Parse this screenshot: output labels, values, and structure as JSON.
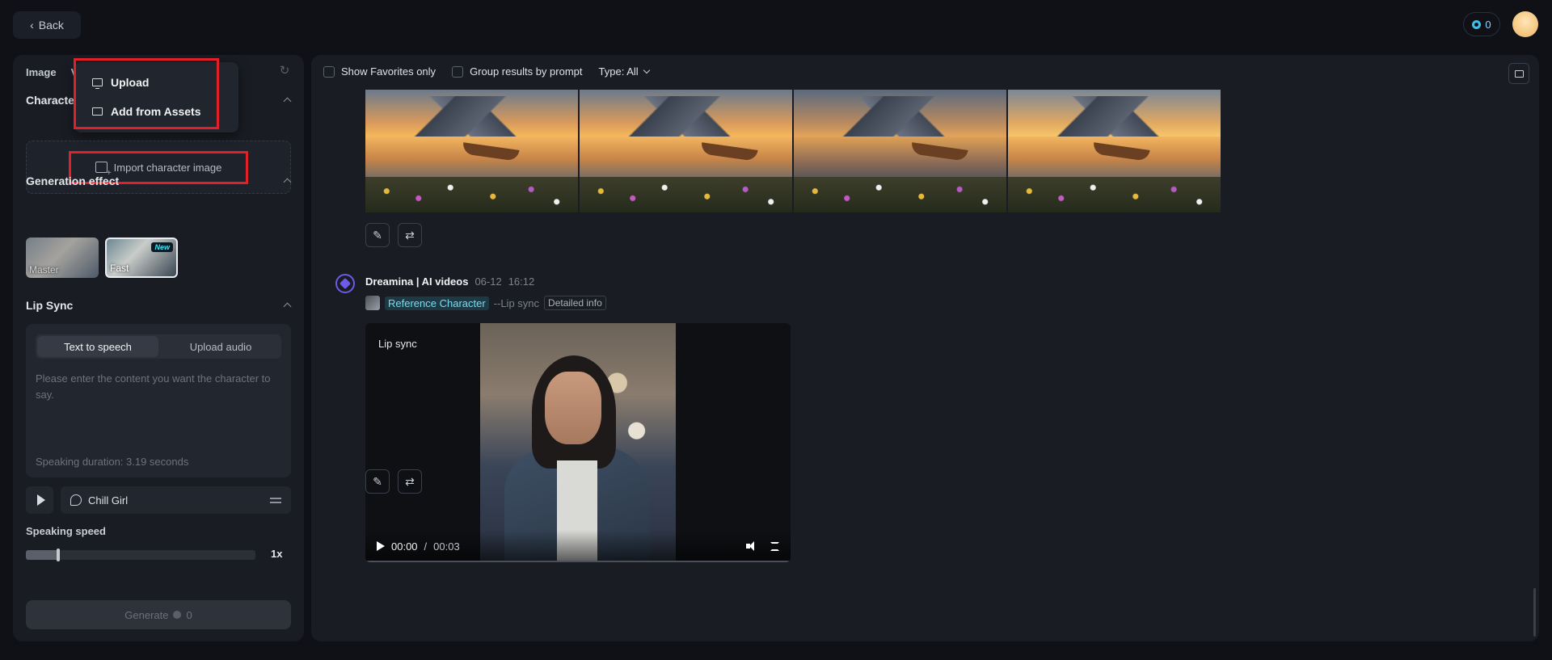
{
  "header": {
    "back_label": "Back",
    "credits": "0"
  },
  "left_panel": {
    "tabs": [
      "Image",
      "V"
    ],
    "character_section": {
      "title": "Character",
      "import_label": "Import character image"
    },
    "dropdown": {
      "items": [
        {
          "label": "Upload",
          "icon": "monitor-icon"
        },
        {
          "label": "Add from Assets",
          "icon": "folder-icon"
        }
      ]
    },
    "generation_effect": {
      "title": "Generation effect",
      "options": [
        {
          "label": "Master",
          "selected": false
        },
        {
          "label": "Fast",
          "selected": true,
          "badge": "New"
        }
      ]
    },
    "lip_sync": {
      "title": "Lip Sync",
      "modes": [
        "Text to speech",
        "Upload audio"
      ],
      "active_mode": "Text to speech",
      "placeholder": "Please enter the content you want the character to say.",
      "duration": "Speaking duration: 3.19 seconds",
      "voice": "Chill Girl"
    },
    "speaking_speed": {
      "label": "Speaking speed",
      "value": "1x",
      "level": 0.14
    },
    "generate": {
      "label": "Generate",
      "cost": "0"
    }
  },
  "main": {
    "filters": {
      "favorites": "Show Favorites only",
      "group": "Group results by prompt",
      "type": "Type: All"
    },
    "message": {
      "sender": "Dreamina | AI videos",
      "date": "06-12",
      "time": "16:12",
      "reference": "Reference Character",
      "mode": "--Lip sync",
      "detail": "Detailed info",
      "video": {
        "title": "Lip sync",
        "current": "00:00",
        "separator": "/",
        "duration": "00:03"
      }
    }
  },
  "colors": {
    "background": "#0f1116",
    "panel": "#191c23",
    "highlight": "#e3202a",
    "accent": "#35c2f5"
  }
}
